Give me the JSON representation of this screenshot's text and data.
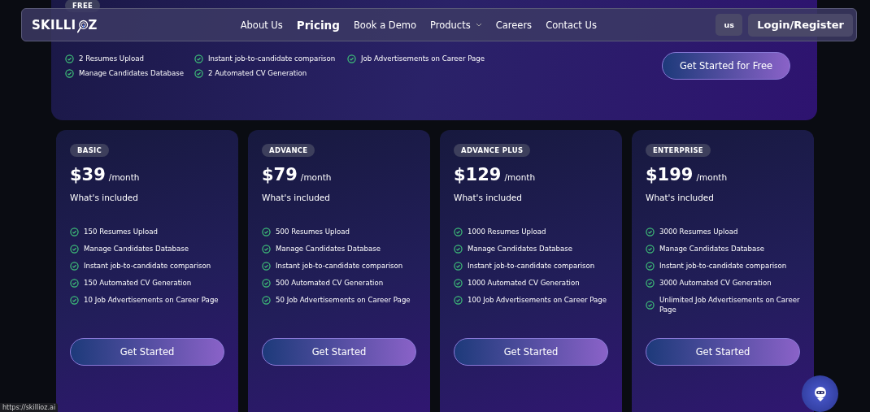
{
  "free_plan": {
    "badge": "FREE",
    "features": [
      "2 Resumes Upload",
      "Instant job-to-candidate comparison",
      "Job Advertisements on Career Page",
      "Manage Candidates Database",
      "2 Automated CV Generation"
    ],
    "button": "Get Started for Free"
  },
  "nav": {
    "logo_start": "SKILLI",
    "logo_end": "Z",
    "links": [
      {
        "label": "About Us",
        "selected": false,
        "dropdown": false
      },
      {
        "label": "Pricing",
        "selected": true,
        "dropdown": false
      },
      {
        "label": "Book a Demo",
        "selected": false,
        "dropdown": false
      },
      {
        "label": "Products",
        "selected": false,
        "dropdown": true
      },
      {
        "label": "Careers",
        "selected": false,
        "dropdown": false
      },
      {
        "label": "Contact Us",
        "selected": false,
        "dropdown": false
      }
    ],
    "language": "us",
    "login": "Login/Register"
  },
  "plans": [
    {
      "badge": "BASIC",
      "price": "$39",
      "period": "/month",
      "included": "What's included",
      "features": [
        "150 Resumes Upload",
        "Manage Candidates Database",
        "Instant job-to-candidate comparison",
        "150 Automated CV Generation",
        "10 Job Advertisements on Career Page"
      ],
      "button": "Get Started"
    },
    {
      "badge": "ADVANCE",
      "price": "$79",
      "period": "/month",
      "included": "What's included",
      "features": [
        "500 Resumes Upload",
        "Manage Candidates Database",
        "Instant job-to-candidate comparison",
        "500 Automated CV Generation",
        "50 Job Advertisements on Career Page"
      ],
      "button": "Get Started"
    },
    {
      "badge": "ADVANCE PLUS",
      "price": "$129",
      "period": "/month",
      "included": "What's included",
      "features": [
        "1000 Resumes Upload",
        "Manage Candidates Database",
        "Instant job-to-candidate comparison",
        "1000 Automated CV Generation",
        "100 Job Advertisements on Career Page"
      ],
      "button": "Get Started"
    },
    {
      "badge": "ENTERPRISE",
      "price": "$199",
      "period": "/month",
      "included": "What's included",
      "features": [
        "3000 Resumes Upload",
        "Manage Candidates Database",
        "Instant job-to-candidate comparison",
        "3000 Automated CV Generation",
        "Unlimited Job Advertisements on Career Page"
      ],
      "button": "Get Started"
    }
  ],
  "status_url": "https://skillioz.ai"
}
